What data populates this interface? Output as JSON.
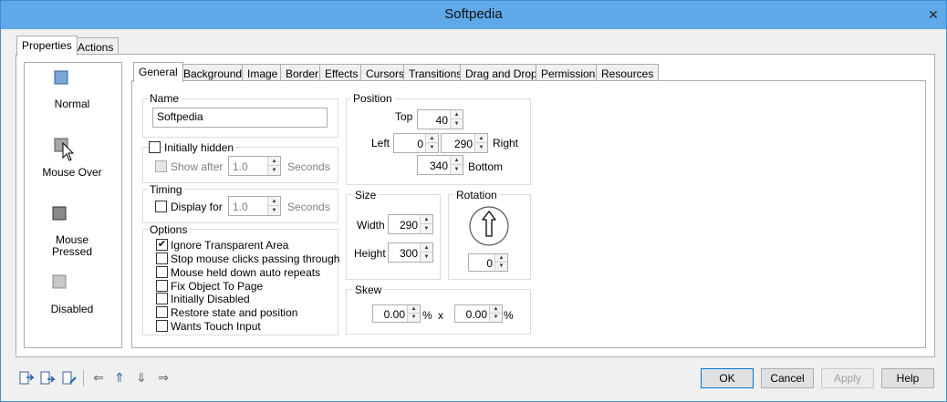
{
  "window": {
    "title": "Softpedia",
    "close_glyph": "✕"
  },
  "outer_tabs": [
    {
      "label": "Properties"
    },
    {
      "label": "Actions"
    }
  ],
  "states": [
    {
      "label": "Normal"
    },
    {
      "label": "Mouse Over"
    },
    {
      "label": "Mouse\nPressed"
    },
    {
      "label": "Disabled"
    }
  ],
  "inner_tabs": [
    {
      "label": "General"
    },
    {
      "label": "Background"
    },
    {
      "label": "Image"
    },
    {
      "label": "Border"
    },
    {
      "label": "Effects"
    },
    {
      "label": "Cursors"
    },
    {
      "label": "Transitions"
    },
    {
      "label": "Drag and Drop"
    },
    {
      "label": "Permissions"
    },
    {
      "label": "Resources"
    }
  ],
  "name_group": {
    "label": "Name",
    "value": "Softpedia"
  },
  "hidden": {
    "checkbox_label": "Initially hidden",
    "show_after_label": "Show after",
    "value": "1.0",
    "unit": "Seconds"
  },
  "timing": {
    "label": "Timing",
    "display_for_label": "Display for",
    "value": "1.0",
    "unit": "Seconds"
  },
  "options": {
    "label": "Options",
    "items": [
      {
        "label": "Ignore Transparent Area",
        "checked": "✔"
      },
      {
        "label": "Stop mouse clicks passing through",
        "checked": ""
      },
      {
        "label": "Mouse held down auto repeats",
        "checked": ""
      },
      {
        "label": "Fix Object To Page",
        "checked": ""
      },
      {
        "label": "Initially Disabled",
        "checked": ""
      },
      {
        "label": "Restore state and position",
        "checked": ""
      },
      {
        "label": "Wants Touch Input",
        "checked": ""
      }
    ]
  },
  "position": {
    "label": "Position",
    "top_label": "Top",
    "top": "40",
    "left_label": "Left",
    "left": "0",
    "right_label": "Right",
    "right": "290",
    "bottom_label": "Bottom",
    "bottom": "340"
  },
  "size": {
    "label": "Size",
    "width_label": "Width",
    "width": "290",
    "height_label": "Height",
    "height": "300"
  },
  "rotation": {
    "label": "Rotation",
    "value": "0"
  },
  "skew": {
    "label": "Skew",
    "x": "0.00",
    "y": "0.00",
    "pct": "%",
    "times": "x"
  },
  "toolbar": {
    "left_arrow": "⇐",
    "up_arrow": "⇑",
    "down_arrow": "⇓",
    "right_arrow": "⇒"
  },
  "buttons": {
    "ok": "OK",
    "cancel": "Cancel",
    "apply": "Apply",
    "help": "Help"
  },
  "colors": {
    "title_bar": "#5fa9e8",
    "accent": "#0078d7",
    "icon_blue": "#1f5fa8"
  }
}
